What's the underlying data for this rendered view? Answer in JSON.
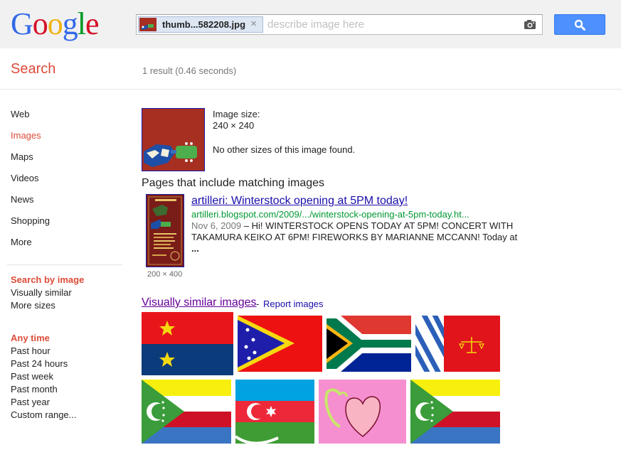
{
  "header": {
    "logo": [
      "G",
      "o",
      "o",
      "g",
      "l",
      "e"
    ],
    "logo_colors": [
      "#3369e8",
      "#d50f25",
      "#eeb211",
      "#3369e8",
      "#009925",
      "#d50f25"
    ],
    "chip_filename": "thumb...582208.jpg",
    "chip_close": "×",
    "search_placeholder": "describe image here",
    "camera_icon": "camera-icon",
    "search_button_icon": "magnifier-icon"
  },
  "section_title": "Search",
  "result_stats": "1 result (0.46 seconds)",
  "nav": {
    "items": [
      "Web",
      "Images",
      "Maps",
      "Videos",
      "News",
      "Shopping",
      "More"
    ],
    "active": "Images",
    "search_by_image": {
      "heading": "Search by image",
      "items": [
        "Visually similar",
        "More sizes"
      ]
    },
    "time": {
      "heading": "Any time",
      "items": [
        "Past hour",
        "Past 24 hours",
        "Past week",
        "Past month",
        "Past year",
        "Custom range..."
      ]
    }
  },
  "image_info": {
    "size_label": "Image size:",
    "size_value": "240 × 240",
    "other_sizes": "No other sizes of this image found."
  },
  "pages_heading": "Pages that include matching images",
  "result": {
    "title": "artilleri: Winterstock opening at 5PM today!",
    "url": "artilleri.blogspot.com/2009/.../winterstock-opening-at-5pm-today.ht...",
    "date": "Nov 6, 2009",
    "snippet": " – Hi! WINTERSTOCK OPENS TODAY AT 5PM! CONCERT WITH TAKAMURA KEIKO AT 6PM! FIREWORKS BY MARIANNE MCCANN! Today at ",
    "ellipsis": "...",
    "thumb_dims": "200 × 400"
  },
  "similar": {
    "link": "Visually similar images",
    "separator": "-",
    "report": "Report images"
  },
  "colors": {
    "accent_red": "#dd4b39",
    "link_blue": "#1a0dab",
    "visited_purple": "#660099",
    "url_green": "#009933",
    "button_blue": "#4d90fe"
  }
}
